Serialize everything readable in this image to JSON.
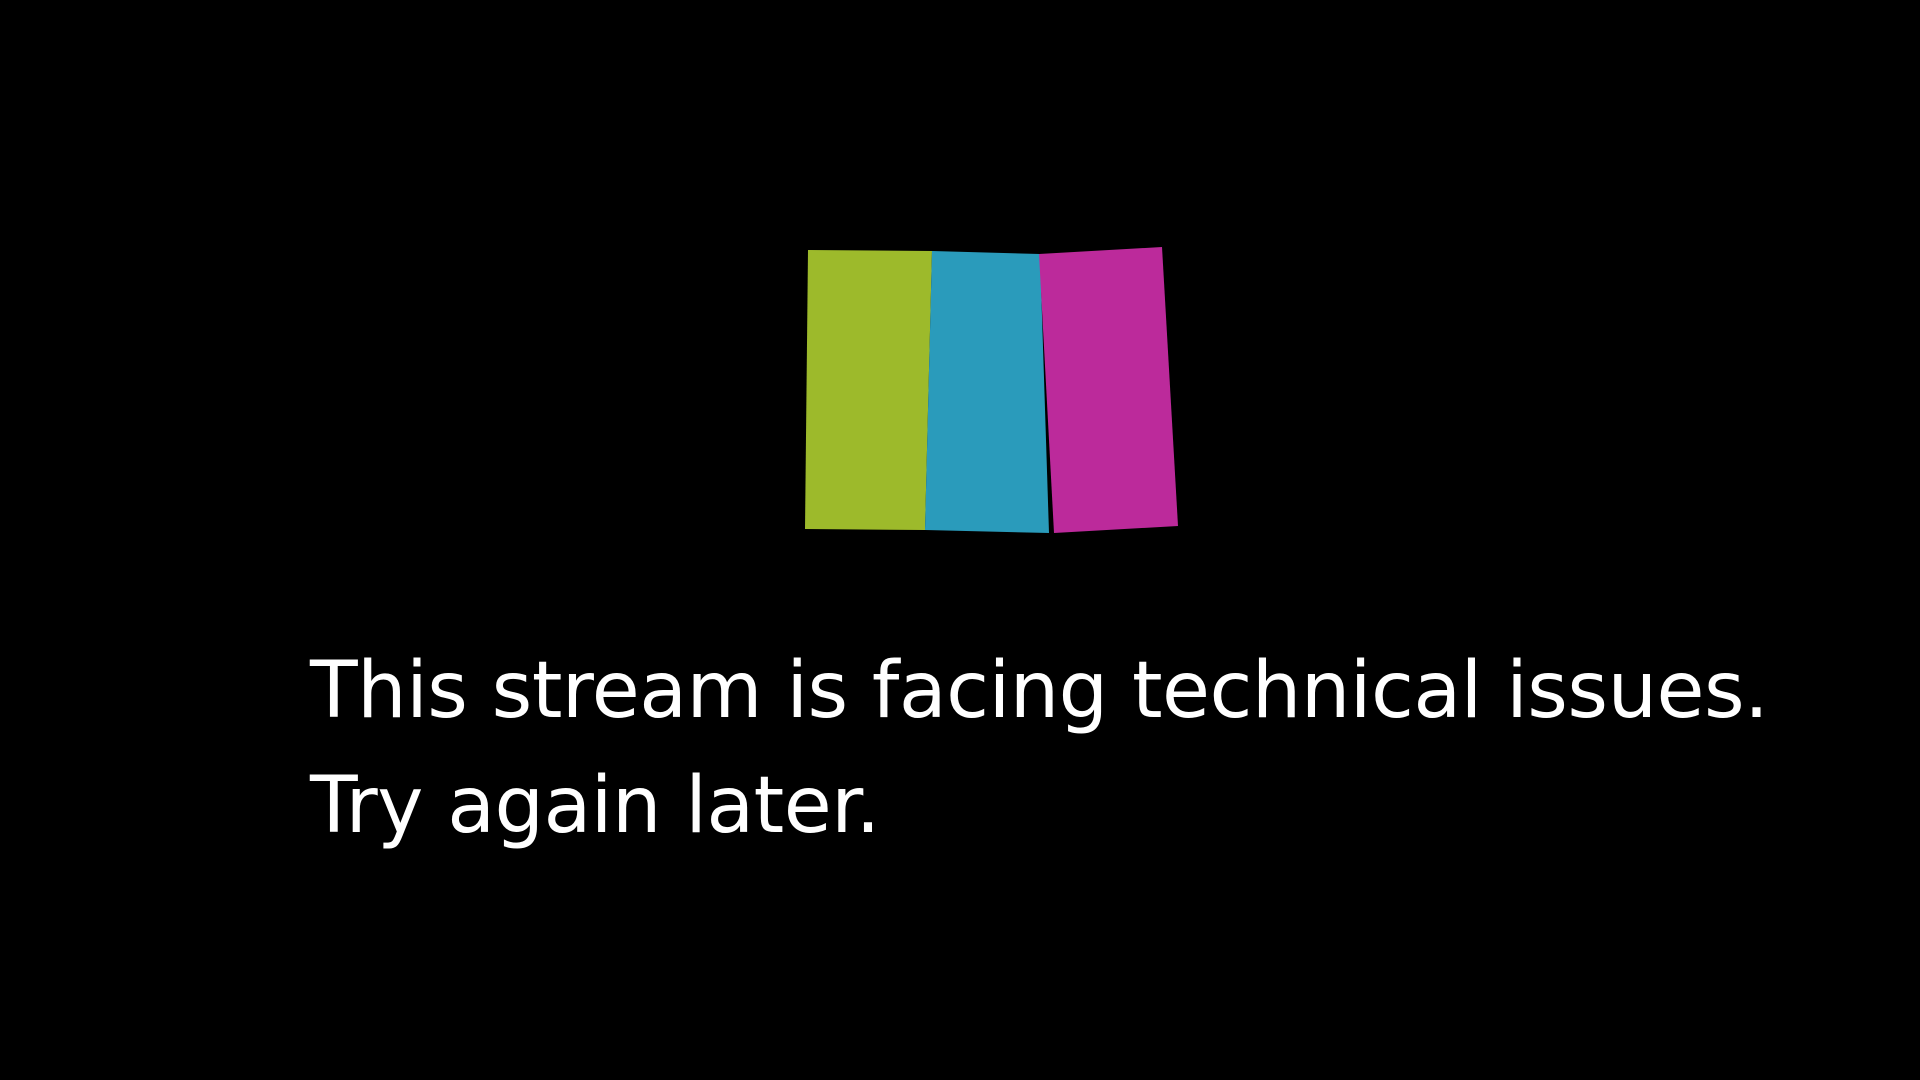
{
  "error_screen": {
    "line1": "This stream is facing technical issues.",
    "line2": "Try again later."
  },
  "logo": {
    "icon": "broken-color-bars-icon",
    "colors": {
      "green": "#9dba2b",
      "blue": "#2a9bbb",
      "magenta": "#bc2a9b"
    }
  }
}
